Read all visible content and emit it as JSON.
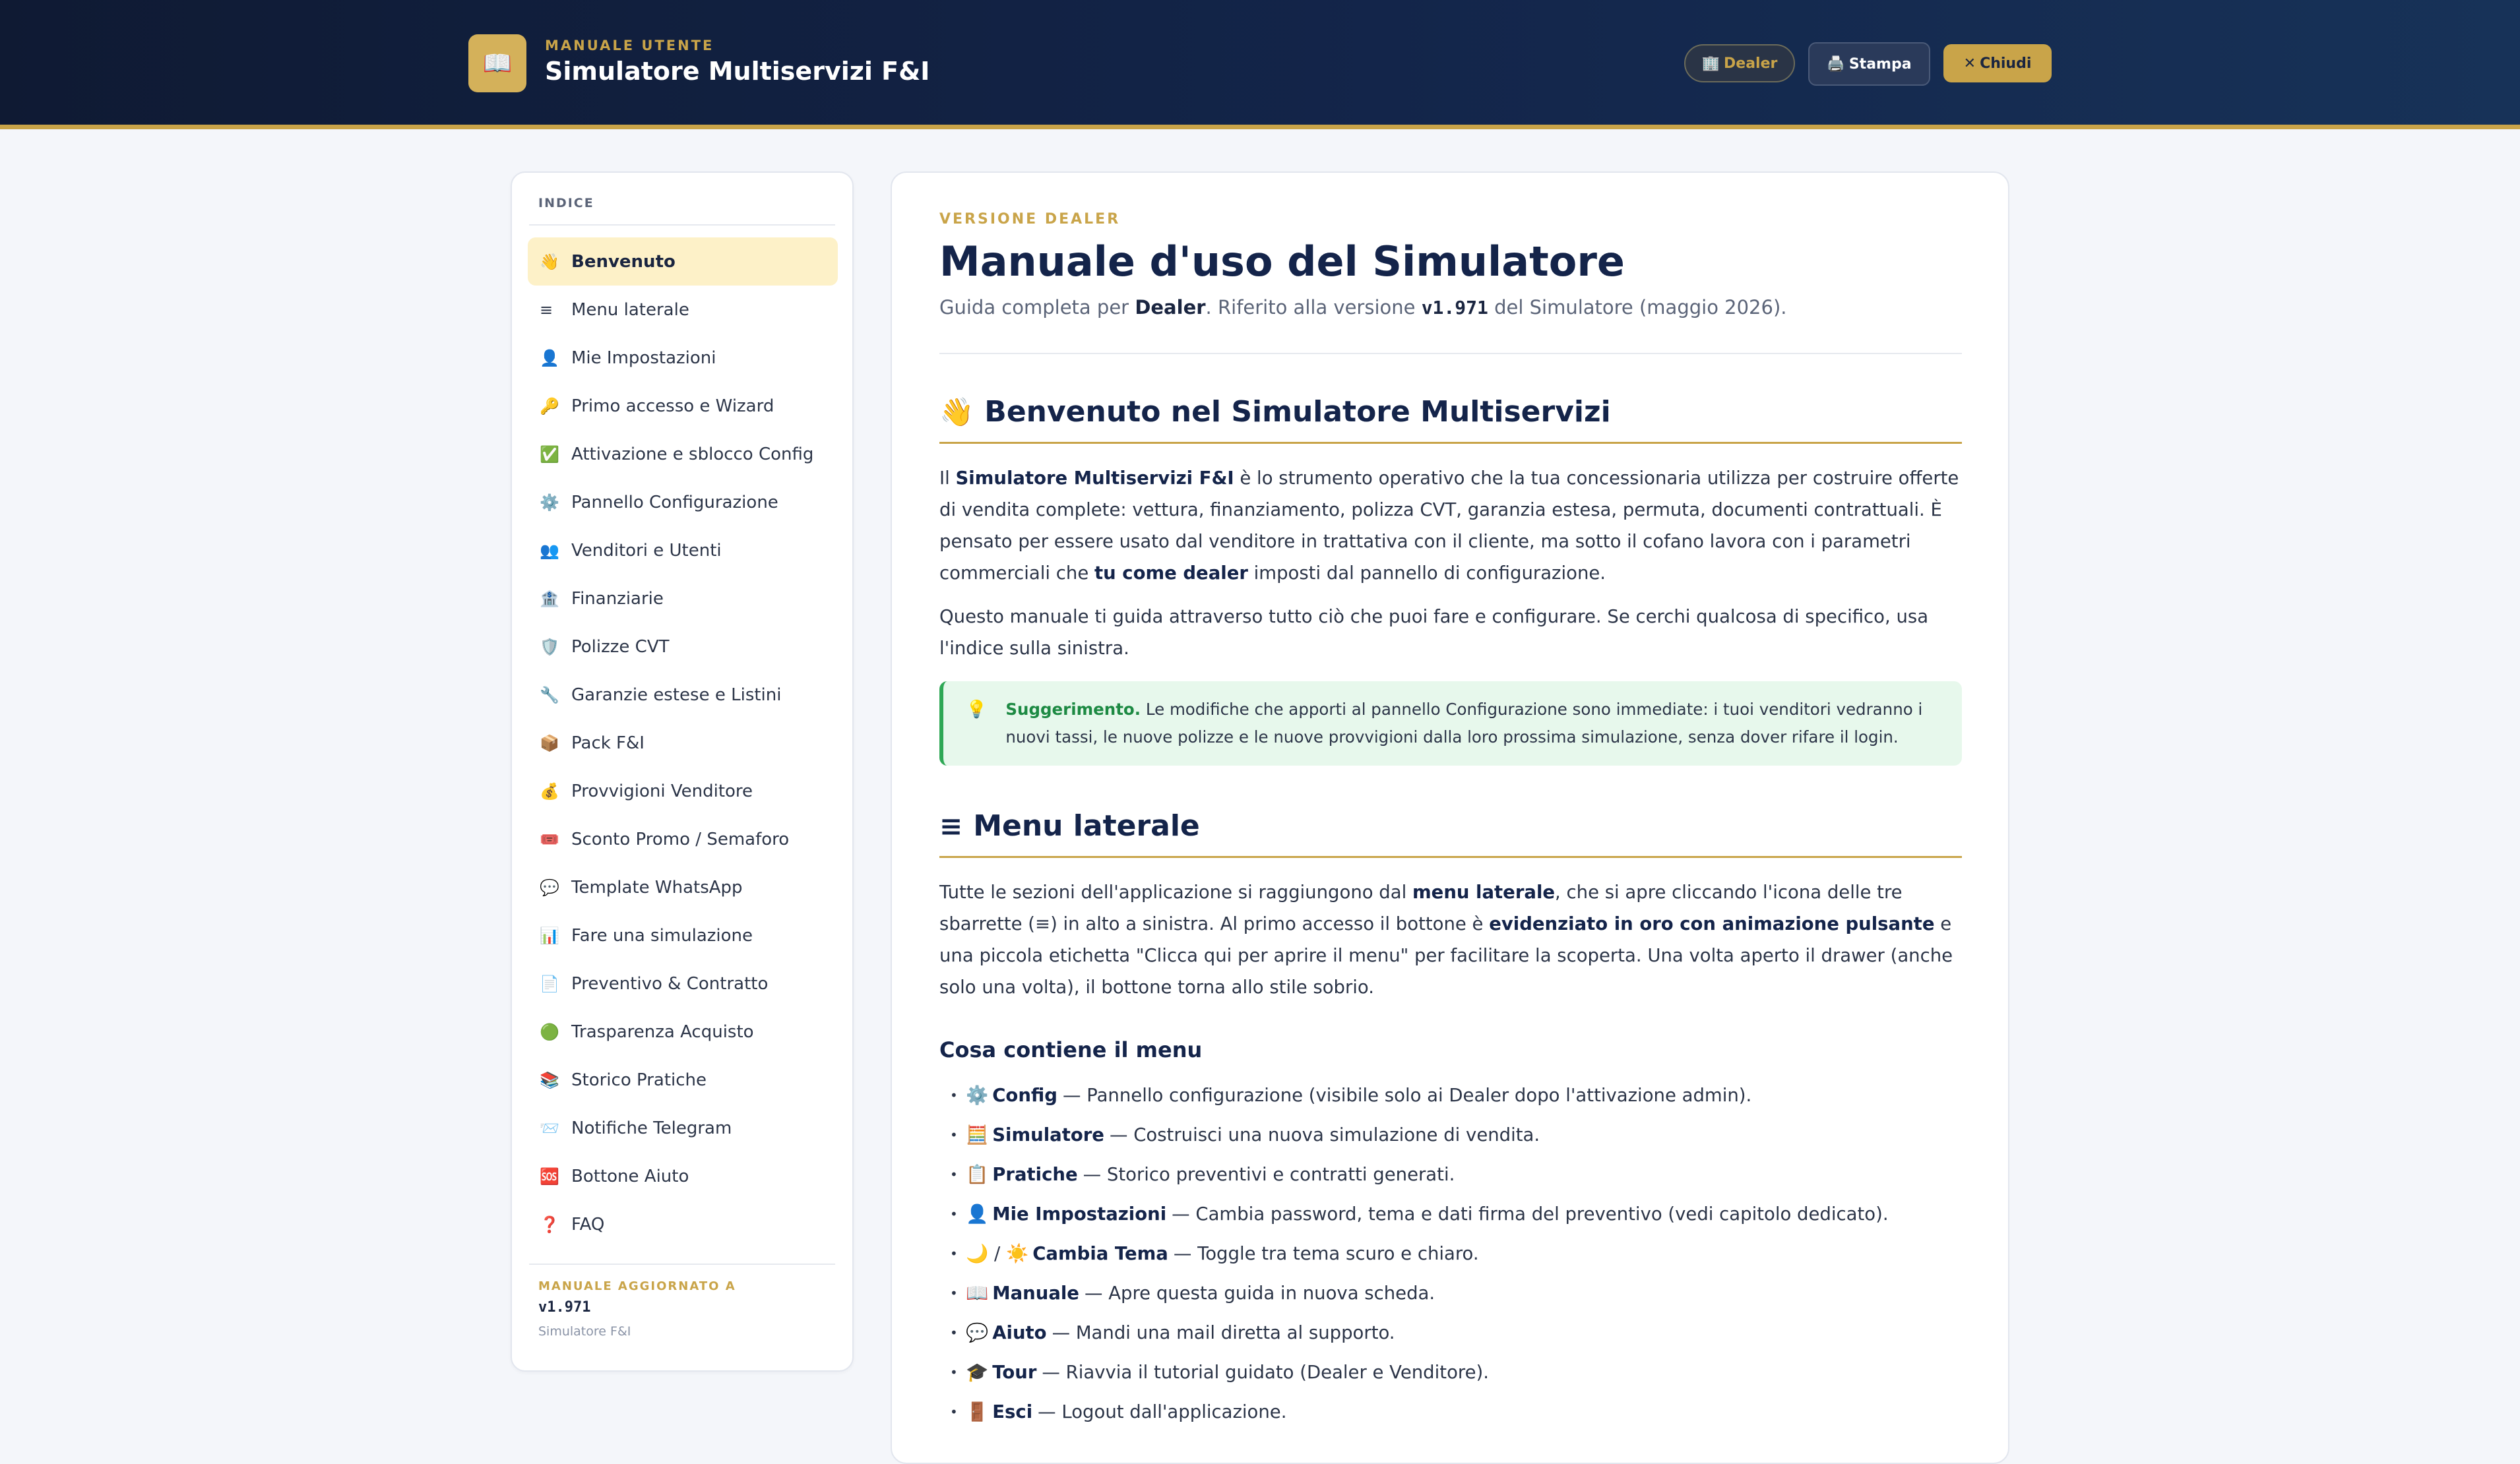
{
  "header": {
    "kicker": "MANUALE UTENTE",
    "title": "Simulatore Multiservizi F&I",
    "brand_icon": "📖",
    "buttons": {
      "dealer": {
        "icon": "🏢",
        "label": "Dealer"
      },
      "print": {
        "icon": "🖨️",
        "label": "Stampa"
      },
      "close": {
        "icon": "✕",
        "label": "Chiudi"
      }
    }
  },
  "sidebar": {
    "heading": "INDICE",
    "items": [
      {
        "icon": "👋",
        "label": "Benvenuto"
      },
      {
        "icon": "≡",
        "label": "Menu laterale"
      },
      {
        "icon": "👤",
        "label": "Mie Impostazioni"
      },
      {
        "icon": "🔑",
        "label": "Primo accesso e Wizard"
      },
      {
        "icon": "✅",
        "label": "Attivazione e sblocco Config"
      },
      {
        "icon": "⚙️",
        "label": "Pannello Configurazione"
      },
      {
        "icon": "👥",
        "label": "Venditori e Utenti"
      },
      {
        "icon": "🏦",
        "label": "Finanziarie"
      },
      {
        "icon": "🛡️",
        "label": "Polizze CVT"
      },
      {
        "icon": "🔧",
        "label": "Garanzie estese e Listini"
      },
      {
        "icon": "📦",
        "label": "Pack F&I"
      },
      {
        "icon": "💰",
        "label": "Provvigioni Venditore"
      },
      {
        "icon": "🎟️",
        "label": "Sconto Promo / Semaforo"
      },
      {
        "icon": "💬",
        "label": "Template WhatsApp"
      },
      {
        "icon": "📊",
        "label": "Fare una simulazione"
      },
      {
        "icon": "📄",
        "label": "Preventivo & Contratto"
      },
      {
        "icon": "🟢",
        "label": "Trasparenza Acquisto"
      },
      {
        "icon": "📚",
        "label": "Storico Pratiche"
      },
      {
        "icon": "📨",
        "label": "Notifiche Telegram"
      },
      {
        "icon": "🆘",
        "label": "Bottone Aiuto"
      },
      {
        "icon": "❓",
        "label": "FAQ"
      }
    ],
    "active_index": 0,
    "footer": {
      "kicker": "MANUALE AGGIORNATO A",
      "version": "v1.971",
      "app": "Simulatore F&I"
    }
  },
  "main": {
    "kicker": "VERSIONE DEALER",
    "title": "Manuale d'uso del Simulatore",
    "subtitle": {
      "prefix": "Guida completa per ",
      "role": "Dealer",
      "middle": ". Riferito alla versione ",
      "version": "v1.971",
      "suffix": " del Simulatore (maggio 2026)."
    },
    "section1": {
      "emoji": "👋",
      "title": "Benvenuto nel Simulatore Multiservizi",
      "p1": {
        "a": "Il ",
        "b": "Simulatore Multiservizi F&I",
        "c": " è lo strumento operativo che la tua concessionaria utilizza per costruire offerte di vendita complete: vettura, finanziamento, polizza CVT, garanzia estesa, permuta, documenti contrattuali. È pensato per essere usato dal venditore in trattativa con il cliente, ma sotto il cofano lavora con i parametri commerciali che ",
        "d": "tu come dealer",
        "e": " imposti dal pannello di configurazione."
      },
      "p2": "Questo manuale ti guida attraverso tutto ciò che puoi fare e configurare. Se cerchi qualcosa di specifico, usa l'indice sulla sinistra.",
      "tip": {
        "icon": "💡",
        "label": "Suggerimento.",
        "text": " Le modifiche che apporti al pannello Configurazione sono immediate: i tuoi venditori vedranno i nuovi tassi, le nuove polizze e le nuove provvigioni dalla loro prossima simulazione, senza dover rifare il login."
      }
    },
    "section2": {
      "emoji": "≡",
      "title": "Menu laterale",
      "p1": {
        "a": "Tutte le sezioni dell'applicazione si raggiungono dal ",
        "b": "menu laterale",
        "c": ", che si apre cliccando l'icona delle tre sbarrette (≡) in alto a sinistra. Al primo accesso il bottone è ",
        "d": "evidenziato in oro con animazione pulsante",
        "e": " e una piccola etichetta \"Clicca qui per aprire il menu\" per facilitare la scoperta. Una volta aperto il drawer (anche solo una volta), il bottone torna allo stile sobrio."
      },
      "subheading": "Cosa contiene il menu",
      "items": [
        {
          "icon": "⚙️",
          "name": "Config",
          "desc": "— Pannello configurazione (visibile solo ai Dealer dopo l'attivazione admin)."
        },
        {
          "icon": "🧮",
          "name": "Simulatore",
          "desc": "— Costruisci una nuova simulazione di vendita."
        },
        {
          "icon": "📋",
          "name": "Pratiche",
          "desc": "— Storico preventivi e contratti generati."
        },
        {
          "icon": "👤",
          "name": "Mie Impostazioni",
          "desc": "— Cambia password, tema e dati firma del preventivo (vedi capitolo dedicato)."
        },
        {
          "icon": "🌙 / ☀️",
          "name": "Cambia Tema",
          "desc": "— Toggle tra tema scuro e chiaro."
        },
        {
          "icon": "📖",
          "name": "Manuale",
          "desc": "— Apre questa guida in nuova scheda."
        },
        {
          "icon": "💬",
          "name": "Aiuto",
          "desc": "— Mandi una mail diretta al supporto."
        },
        {
          "icon": "🎓",
          "name": "Tour",
          "desc": "— Riavvia il tutorial guidato (Dealer e Venditore)."
        },
        {
          "icon": "🚪",
          "name": "Esci",
          "desc": "— Logout dall'applicazione."
        }
      ]
    }
  }
}
